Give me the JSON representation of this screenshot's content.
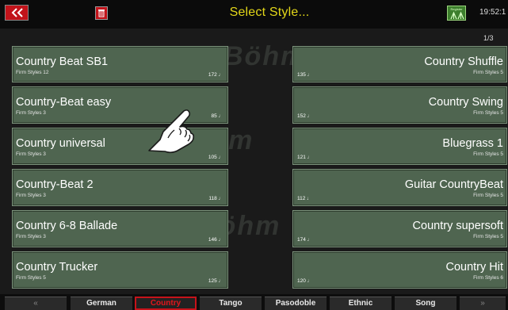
{
  "header": {
    "title": "Select Style...",
    "time": "19:52:1",
    "page": "1/3",
    "register_label": "Register",
    "icons": {
      "back": "double-chevron-left-icon",
      "delete": "trash-icon",
      "register": "register-icon"
    }
  },
  "watermark": [
    "Böhm",
    "Böhm",
    "Böhm"
  ],
  "styles_left": [
    {
      "name": "Country Beat SB1",
      "category": "Firm Styles 12",
      "tempo": "172 ♩"
    },
    {
      "name": "Country-Beat easy",
      "category": "Firm Styles 3",
      "tempo": "85 ♩"
    },
    {
      "name": "Country universal",
      "category": "Firm Styles 3",
      "tempo": "105 ♩"
    },
    {
      "name": "Country-Beat 2",
      "category": "Firm Styles 3",
      "tempo": "118 ♩"
    },
    {
      "name": "Country 6-8 Ballade",
      "category": "Firm Styles 3",
      "tempo": "146 ♩"
    },
    {
      "name": "Country Trucker",
      "category": "Firm Styles 5",
      "tempo": "125 ♩"
    }
  ],
  "styles_right": [
    {
      "name": "Country Shuffle",
      "category": "Firm Styles 5",
      "tempo": "135 ♩"
    },
    {
      "name": "Country Swing",
      "category": "Firm Styles 5",
      "tempo": "152 ♩"
    },
    {
      "name": "Bluegrass 1",
      "category": "Firm Styles 5",
      "tempo": "121 ♩"
    },
    {
      "name": "Guitar CountryBeat",
      "category": "Firm Styles 5",
      "tempo": "112 ♩"
    },
    {
      "name": "Country supersoft",
      "category": "Firm Styles 5",
      "tempo": "174 ♩"
    },
    {
      "name": "Country Hit",
      "category": "Firm Styles 6",
      "tempo": "120 ♩"
    }
  ],
  "tabs": {
    "prev": "«",
    "next": "»",
    "items": [
      "German",
      "Country",
      "Tango",
      "Pasodoble",
      "Ethnic",
      "Song"
    ],
    "active": "Country"
  },
  "colors": {
    "title": "#e3d719",
    "tile": "#4f6550",
    "active_tab": "#e3161c",
    "button": "#c1131a"
  }
}
